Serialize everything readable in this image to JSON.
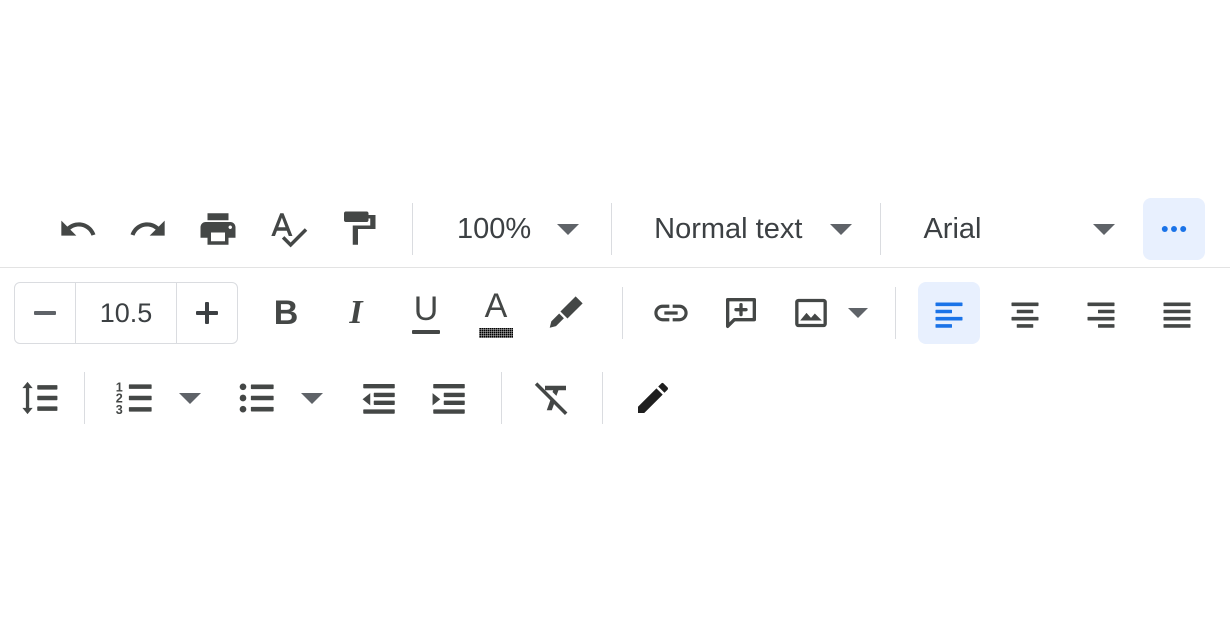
{
  "app": {
    "surface": "document-editor-toolbar",
    "background": "#ffffff",
    "icon_color": "#444746",
    "accent": "#1a73e8",
    "accent_bg": "#e8f0fe",
    "divider": "#dadce0"
  },
  "toolbar": {
    "row1": {
      "undo": {
        "label": "Undo",
        "icon": "undo-icon"
      },
      "redo": {
        "label": "Redo",
        "icon": "redo-icon"
      },
      "print": {
        "label": "Print",
        "icon": "print-icon"
      },
      "spelling": {
        "label": "Spelling and grammar check",
        "icon": "spellcheck-icon"
      },
      "paint_format": {
        "label": "Paint format",
        "icon": "paint-format-icon"
      },
      "zoom": {
        "value": "100%",
        "label": "Zoom",
        "icon": "chevron-down-icon"
      },
      "style": {
        "value": "Normal text",
        "label": "Styles",
        "icon": "chevron-down-icon"
      },
      "font": {
        "value": "Arial",
        "label": "Font",
        "icon": "chevron-down-icon"
      },
      "more": {
        "label": "More",
        "icon": "more-horiz-icon",
        "active": true
      }
    },
    "row2": {
      "font_size": {
        "decrease_label": "Decrease font size",
        "value": "10.5",
        "increase_label": "Increase font size"
      },
      "bold": {
        "label": "Bold",
        "glyph": "B"
      },
      "italic": {
        "label": "Italic",
        "glyph": "I"
      },
      "underline": {
        "label": "Underline",
        "glyph": "U"
      },
      "text_color": {
        "label": "Text color",
        "glyph": "A",
        "swatch": "#000000"
      },
      "highlight": {
        "label": "Highlight color",
        "icon": "highlighter-icon"
      },
      "link": {
        "label": "Insert link",
        "icon": "link-icon"
      },
      "comment": {
        "label": "Add comment",
        "icon": "add-comment-icon"
      },
      "image": {
        "label": "Insert image",
        "icon": "image-icon"
      },
      "image_caret": {
        "label": "Insert image options",
        "icon": "chevron-down-icon"
      },
      "align_left": {
        "label": "Left align",
        "icon": "align-left-icon",
        "active": true
      },
      "align_center": {
        "label": "Center align",
        "icon": "align-center-icon",
        "active": false
      },
      "align_right": {
        "label": "Right align",
        "icon": "align-right-icon",
        "active": false
      },
      "align_justify": {
        "label": "Justify",
        "icon": "align-justify-icon",
        "active": false
      }
    },
    "row3": {
      "line_spacing": {
        "label": "Line & paragraph spacing",
        "icon": "line-spacing-icon"
      },
      "numbered_list": {
        "label": "Numbered list",
        "icon": "numbered-list-icon"
      },
      "numbered_caret": {
        "label": "Numbered list options",
        "icon": "chevron-down-icon"
      },
      "bulleted_list": {
        "label": "Bulleted list",
        "icon": "bulleted-list-icon"
      },
      "bulleted_caret": {
        "label": "Bulleted list options",
        "icon": "chevron-down-icon"
      },
      "decrease_indent": {
        "label": "Decrease indent",
        "icon": "decrease-indent-icon"
      },
      "increase_indent": {
        "label": "Increase indent",
        "icon": "increase-indent-icon"
      },
      "clear_formatting": {
        "label": "Clear formatting",
        "icon": "clear-formatting-icon"
      },
      "editing_mode": {
        "label": "Editing mode",
        "icon": "pencil-icon"
      }
    }
  }
}
